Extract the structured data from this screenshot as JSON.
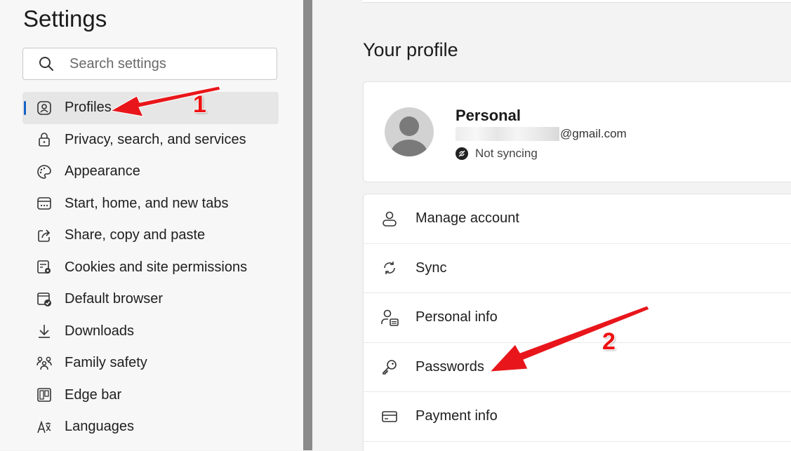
{
  "sidebar": {
    "title": "Settings",
    "search_placeholder": "Search settings",
    "items": [
      {
        "label": "Profiles",
        "icon": "profiles-icon",
        "active": true
      },
      {
        "label": "Privacy, search, and services",
        "icon": "lock-icon"
      },
      {
        "label": "Appearance",
        "icon": "palette-icon"
      },
      {
        "label": "Start, home, and new tabs",
        "icon": "start-home-icon"
      },
      {
        "label": "Share, copy and paste",
        "icon": "share-icon"
      },
      {
        "label": "Cookies and site permissions",
        "icon": "cookies-icon"
      },
      {
        "label": "Default browser",
        "icon": "default-browser-icon"
      },
      {
        "label": "Downloads",
        "icon": "download-icon"
      },
      {
        "label": "Family safety",
        "icon": "family-icon"
      },
      {
        "label": "Edge bar",
        "icon": "edge-bar-icon"
      },
      {
        "label": "Languages",
        "icon": "languages-icon"
      }
    ]
  },
  "main": {
    "heading": "Your profile",
    "profile": {
      "name": "Personal",
      "email_suffix": "@gmail.com",
      "sync_status": "Not syncing"
    },
    "rows": [
      {
        "label": "Manage account",
        "icon": "person-icon"
      },
      {
        "label": "Sync",
        "icon": "sync-icon"
      },
      {
        "label": "Personal info",
        "icon": "personal-info-icon"
      },
      {
        "label": "Passwords",
        "icon": "key-icon"
      },
      {
        "label": "Payment info",
        "icon": "card-icon"
      }
    ]
  },
  "annotations": {
    "one": "1",
    "two": "2",
    "color": "#e8161b"
  },
  "colors": {
    "accent": "#1463c7",
    "divider": "#8a8a8a"
  }
}
